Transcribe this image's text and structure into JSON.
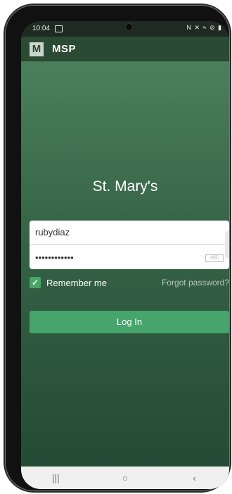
{
  "status": {
    "time": "10:04",
    "icons": "N ✕ ≈ ⊘ ▮"
  },
  "app": {
    "logo_letter": "M",
    "title": "MSP"
  },
  "login": {
    "org_name": "St. Mary's",
    "username": "rubydiaz",
    "password_mask": "••••••••••••",
    "password_keyboard_hint": "ABC",
    "remember_label": "Remember me",
    "remember_checked": true,
    "forgot_label": "Forgot password?",
    "login_label": "Log In"
  },
  "navbar": {
    "recent": "|||",
    "home": "○",
    "back": "‹"
  },
  "colors": {
    "accent": "#46a46c",
    "background_top": "#4b7f5c",
    "background_bottom": "#234a32",
    "appbar": "#2b4a33"
  }
}
